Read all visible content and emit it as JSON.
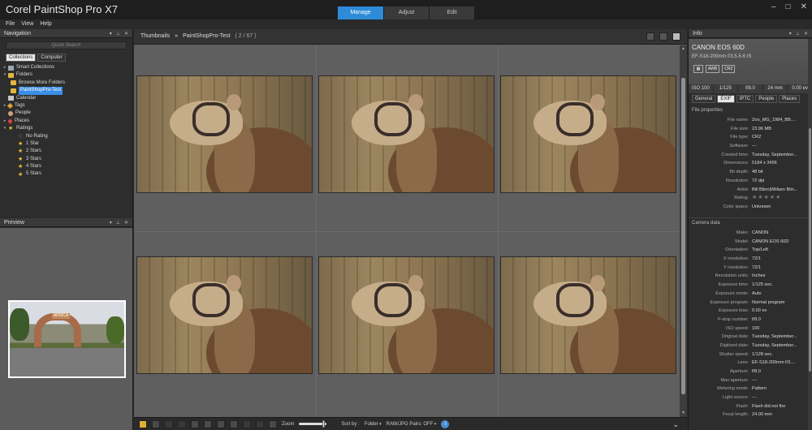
{
  "app": {
    "title": "Corel PaintShop Pro X7"
  },
  "workspace_tabs": [
    "Manage",
    "Adjust",
    "Edit"
  ],
  "window_buttons": [
    "–",
    "□",
    "✕"
  ],
  "menu": [
    "File",
    "View",
    "Help"
  ],
  "navigation": {
    "title": "Navigation",
    "quick_search_placeholder": "Quick Search",
    "tabs": [
      "Collections",
      "Computer"
    ],
    "tree": {
      "smart_collections": "Smart Collections",
      "folders": "Folders",
      "browse_more": "Browse More Folders",
      "selected_folder": "PaintShopPro-Test",
      "calendar": "Calendar",
      "tags": "Tags",
      "people": "People",
      "places": "Places",
      "ratings": "Ratings",
      "no_rating": "No Rating",
      "stars": [
        "1 Star",
        "2 Stars",
        "3 Stars",
        "4 Stars",
        "5 Stars"
      ]
    }
  },
  "preview": {
    "title": "Preview",
    "sign_text": "AFRICA"
  },
  "thumbnails": {
    "label": "Thumbnails",
    "separator": "»",
    "folder": "PaintShopPro-Test",
    "count": "( 2 / 67 )",
    "items": 6
  },
  "bottom_bar": {
    "zoom_label": "Zoom",
    "zoom_level": 0.92,
    "sort_label": "Sort by :",
    "sort_value": "Folder",
    "raw_pairs": "RAW/JPG Pairs: OFF"
  },
  "info": {
    "title": "Info",
    "camera": "CANON EOS 60D",
    "lens": "EF-S18-200mm f/3.5-5.6 IS",
    "icons": [
      "AWB",
      "CR2"
    ],
    "stats": [
      "ISO 100",
      "1/125",
      "f/8.0",
      "24 mm",
      "0.00 ev"
    ],
    "tabs": [
      "General",
      "EXIF",
      "IPTC",
      "People",
      "Places"
    ],
    "file_section": "File properties",
    "file_props": [
      [
        "File name:",
        "Zoo_MG_1984_BB...."
      ],
      [
        "File size:",
        "23.96 MB"
      ],
      [
        "File type:",
        "CR2"
      ],
      [
        "Software:",
        "---"
      ],
      [
        "Created time:",
        "Tuesday, September..."
      ],
      [
        "Dimensions:",
        "5184 x 3456"
      ],
      [
        "Bit depth:",
        "48 bit"
      ],
      [
        "Resolution:",
        "72 dpi"
      ],
      [
        "Artist:",
        "Bill Blinn|William Blin..."
      ],
      [
        "Rating:",
        "★★★★★"
      ],
      [
        "Color space:",
        "Unknown"
      ]
    ],
    "camera_section": "Camera data",
    "camera_props": [
      [
        "Make:",
        "CANON"
      ],
      [
        "Model:",
        "CANON EOS 60D"
      ],
      [
        "Orientation:",
        "Top/Left"
      ],
      [
        "X resolution:",
        "72/1"
      ],
      [
        "Y resolution:",
        "72/1"
      ],
      [
        "Resolution units:",
        "Inches"
      ],
      [
        "Exposure time:",
        "1/125 sec."
      ],
      [
        "Exposure mode:",
        "Auto"
      ],
      [
        "Exposure program:",
        "Normal program"
      ],
      [
        "Exposure bias:",
        "0.00 ev"
      ],
      [
        "F-stop number:",
        "f/8.0"
      ],
      [
        "ISO speed:",
        "100"
      ],
      [
        "Original date:",
        "Tuesday, September..."
      ],
      [
        "Digitized date:",
        "Tuesday, September..."
      ],
      [
        "Shutter speed:",
        "1/128 sec."
      ],
      [
        "Lens:",
        "EF-S18-200mm f/3...."
      ],
      [
        "Aperture:",
        "f/8.0"
      ],
      [
        "Max aperture:",
        "---"
      ],
      [
        "Metering mode:",
        "Pattern"
      ],
      [
        "Light source:",
        "---"
      ],
      [
        "Flash:",
        "Flash did not fire"
      ],
      [
        "Focal length:",
        "24.00 mm"
      ]
    ]
  }
}
